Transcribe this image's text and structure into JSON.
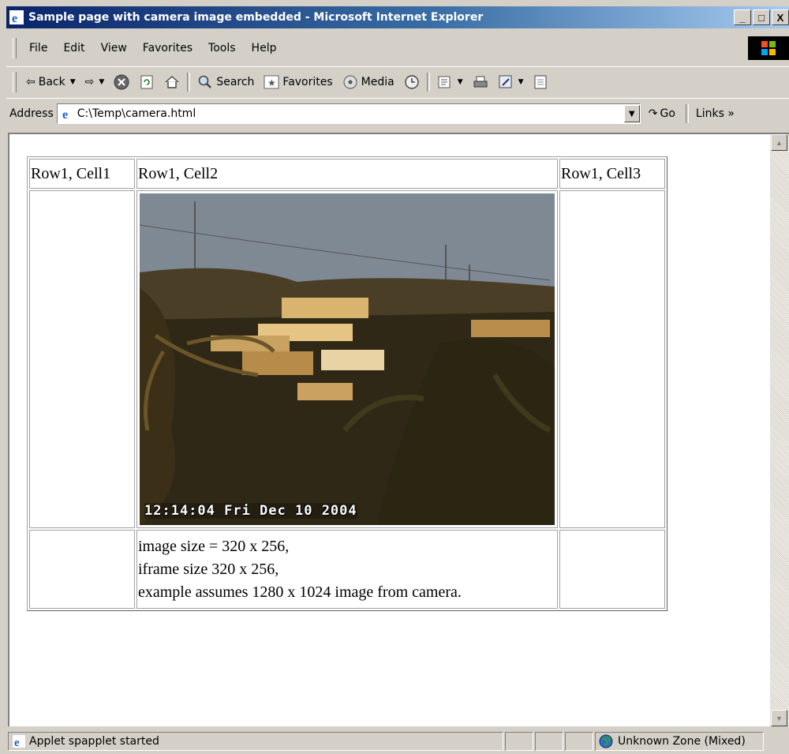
{
  "window": {
    "title": "Sample page with camera image embedded - Microsoft Internet Explorer",
    "minimize": "_",
    "maximize": "□",
    "close": "X"
  },
  "menu": [
    "File",
    "Edit",
    "View",
    "Favorites",
    "Tools",
    "Help"
  ],
  "toolbar": {
    "back": "Back",
    "search": "Search",
    "favorites": "Favorites",
    "media": "Media"
  },
  "address": {
    "label": "Address",
    "value": "C:\\Temp\\camera.html",
    "go": "Go",
    "links": "Links »"
  },
  "table": {
    "header": [
      "Row1, Cell1",
      "Row1, Cell2",
      "Row1, Cell3"
    ],
    "camera_timestamp": "12:14:04 Fri  Dec 10 2004",
    "caption": [
      "image size = 320 x 256,",
      "iframe size 320 x 256,",
      "example assumes 1280 x 1024 image from camera."
    ]
  },
  "status": {
    "message": "Applet spapplet started",
    "zone": "Unknown Zone (Mixed)"
  }
}
